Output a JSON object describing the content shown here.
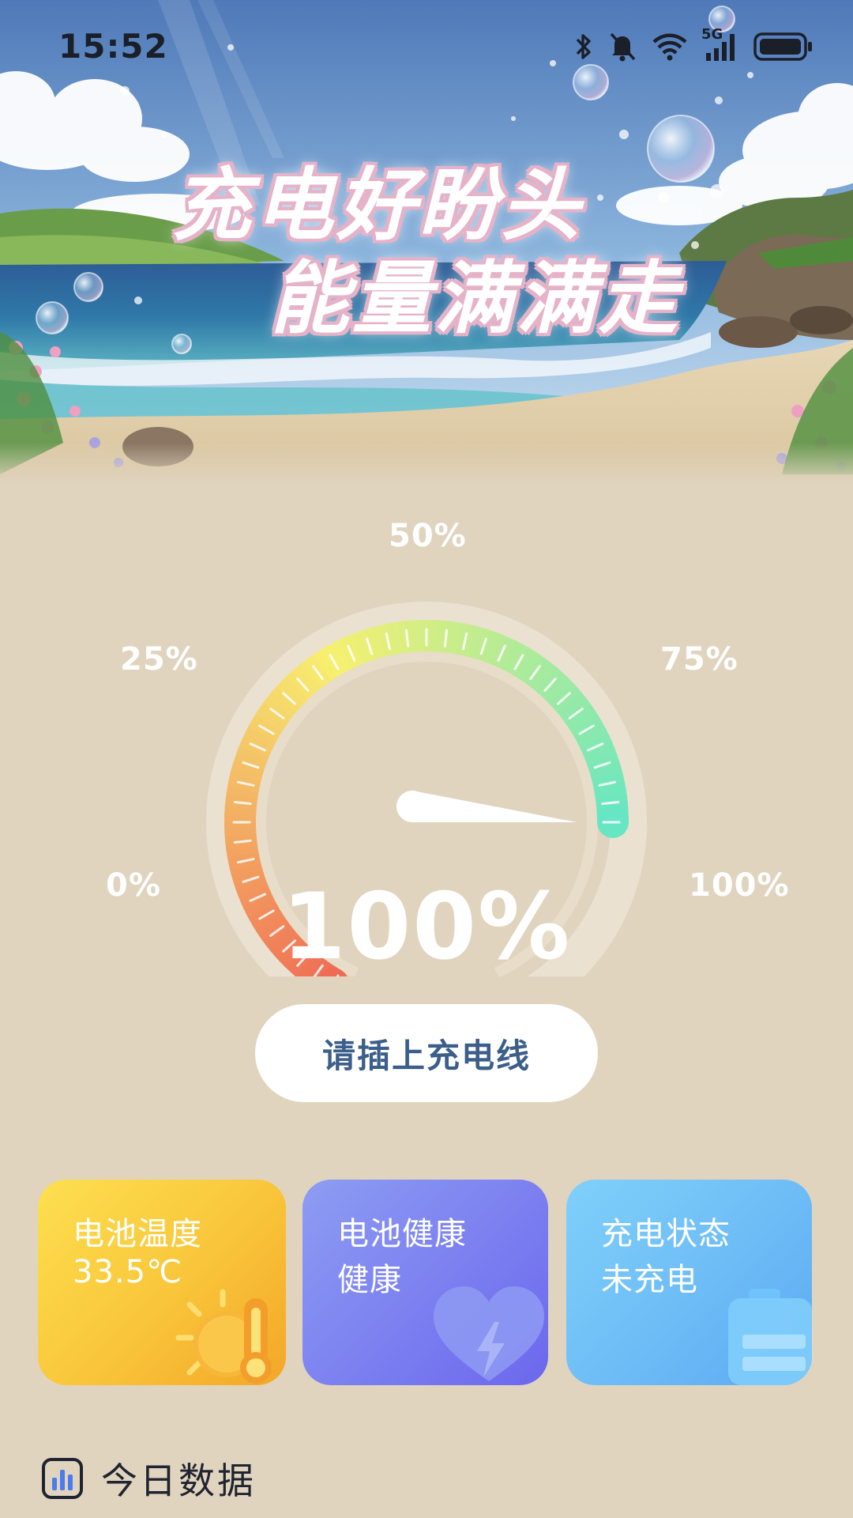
{
  "status_bar": {
    "time": "15:52",
    "network_label": "5G",
    "icons": [
      "bluetooth-icon",
      "mute-bell-icon",
      "wifi-icon",
      "signal-icon",
      "battery-icon"
    ]
  },
  "hero": {
    "headline_line1": "充电好盼头",
    "headline_line2": "能量满满走"
  },
  "gauge": {
    "labels": {
      "p0": "0%",
      "p25": "25%",
      "p50": "50%",
      "p75": "75%",
      "p100": "100%"
    },
    "value_text": "100%",
    "level_percent": 100,
    "colors": {
      "low": "#ef6b55",
      "mid": "#f7f070",
      "high": "#66e6c3"
    }
  },
  "action": {
    "plug_label": "请插上充电线"
  },
  "cards": {
    "temperature": {
      "title": "电池温度",
      "value": "33.5℃",
      "icon": "sun-thermometer-icon"
    },
    "health": {
      "title": "电池健康",
      "value": "健康",
      "icon": "heart-bolt-icon"
    },
    "charge": {
      "title": "充电状态",
      "value": "未充电",
      "icon": "battery-outline-icon"
    }
  },
  "today": {
    "title": "今日数据",
    "icon": "bar-chart-icon"
  }
}
